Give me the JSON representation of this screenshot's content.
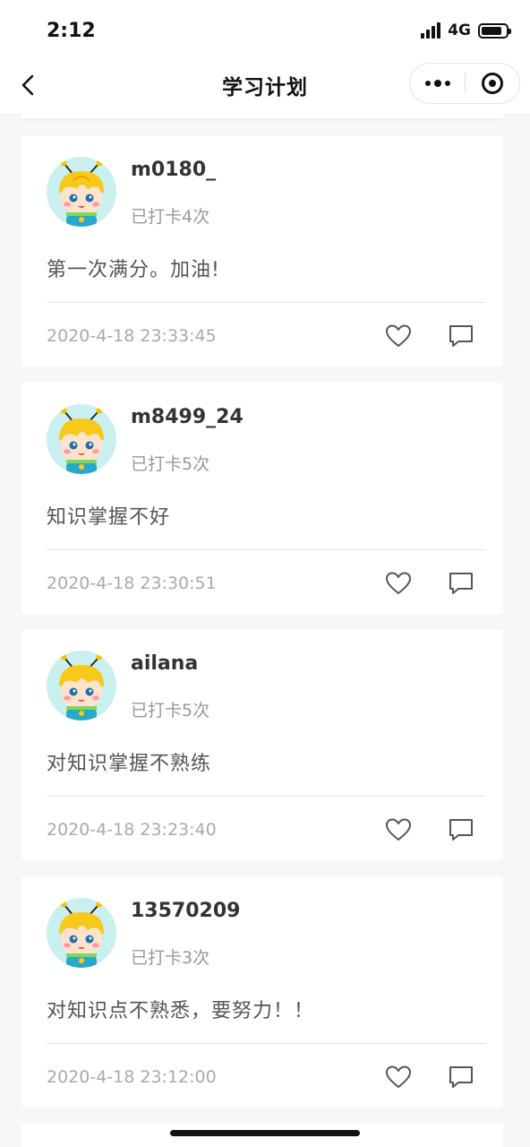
{
  "status_bar": {
    "time": "2:12",
    "network": "4G"
  },
  "nav": {
    "title": "学习计划"
  },
  "colors": {
    "background": "#f7f7f7",
    "card": "#ffffff",
    "muted_text": "#999999",
    "avatar_bg": "#c9f0ef"
  },
  "posts": [
    {
      "username": "m0180_",
      "checkins": "已打卡4次",
      "comment": "第一次满分。加油!",
      "timestamp": "2020-4-18 23:33:45"
    },
    {
      "username": "m8499_24",
      "checkins": "已打卡5次",
      "comment": "知识掌握不好",
      "timestamp": "2020-4-18 23:30:51"
    },
    {
      "username": "ailana",
      "checkins": "已打卡5次",
      "comment": "对知识掌握不熟练",
      "timestamp": "2020-4-18 23:23:40"
    },
    {
      "username": "13570209",
      "checkins": "已打卡3次",
      "comment": "对知识点不熟悉，要努力！！",
      "timestamp": "2020-4-18 23:12:00"
    }
  ],
  "icons": {
    "back": "chevron-left-icon",
    "more": "more-dots-icon",
    "close": "target-circle-icon",
    "like": "heart-outline-icon",
    "comment": "comment-bubble-icon",
    "avatar": "bee-avatar-icon"
  }
}
